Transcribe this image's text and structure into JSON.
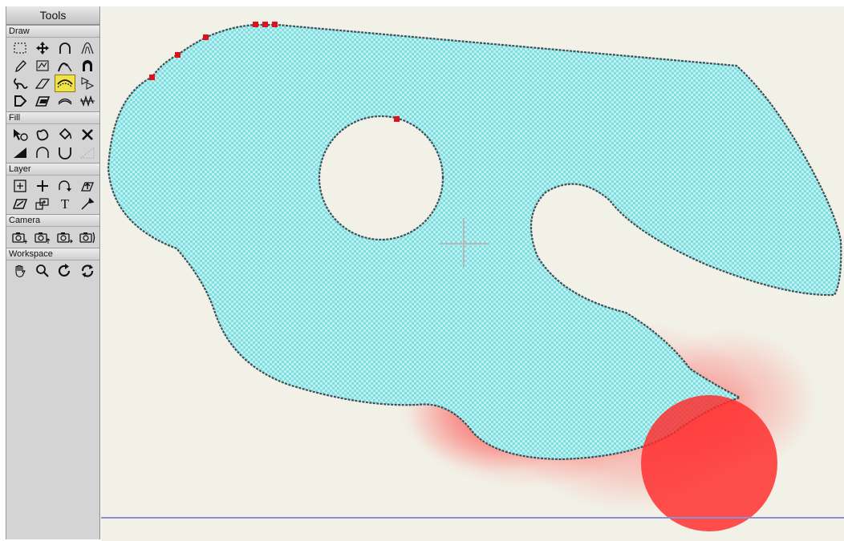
{
  "palette": {
    "title": "Tools",
    "sections": [
      {
        "label": "Draw",
        "tools": [
          "marquee-select-icon",
          "move-icon",
          "arc-icon",
          "arch-outline-icon",
          "pencil-icon",
          "polygon-image-icon",
          "curve-edit-icon",
          "magnet-arc-icon",
          "freehand-curve-icon",
          "eraser-icon",
          "smooth-stroke-icon",
          "scale-arrows-icon",
          "d-shape-icon",
          "skew-shape-icon",
          "bend-icon",
          "zigzag-icon"
        ],
        "active": "smooth-stroke-icon"
      },
      {
        "label": "Fill",
        "tools": [
          "select-fill-icon",
          "shape-fill-icon",
          "paint-bucket-icon",
          "delete-fill-icon",
          "gradient-wedge-icon",
          "arc-fill-icon",
          "u-curve-icon",
          "dotted-wedge-icon"
        ]
      },
      {
        "label": "Layer",
        "tools": [
          "add-layer-icon",
          "plus-icon",
          "arc-arrow-icon",
          "layer-up-icon",
          "layer-skew-icon",
          "layer-stack-icon",
          "text-icon",
          "eyedropper-icon"
        ]
      },
      {
        "label": "Camera",
        "tools": [
          "camera-plus-icon",
          "camera-move-icon",
          "camera-right-icon",
          "camera-bracket-icon"
        ]
      },
      {
        "label": "Workspace",
        "tools": [
          "hand-icon",
          "magnify-icon",
          "rotate-icon",
          "refresh-icon"
        ]
      }
    ]
  },
  "canvas": {
    "background": "#f2f1e7",
    "shape_fill": "#7fdfe0",
    "outline_color": "#3d4f57",
    "control_point_color": "#e0101a",
    "brush_color": "#ff2a2a",
    "ground_line_color": "#8d8ed4"
  }
}
